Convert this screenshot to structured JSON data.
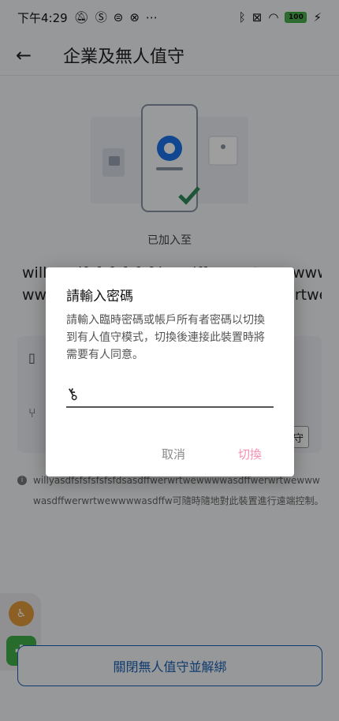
{
  "status": {
    "time": "下午4:29",
    "left_icons": [
      "notifications-off-icon",
      "s-icon",
      "vpn-icon",
      "app-icon",
      "more-dots-icon"
    ],
    "right_icons": [
      "bluetooth-icon",
      "no-sim-icon",
      "wifi-icon",
      "battery-icon",
      "charging-icon"
    ],
    "battery": "100"
  },
  "appbar": {
    "title": "企業及無人值守"
  },
  "content": {
    "added_label": "已加入至",
    "org_name_line1": "willyasdfsfsfsfsfsfdsasdffwerwrtwewwwww",
    "org_name_line2": "wwwasdffwerwrtwewwwwasdffwerwrtwewwwww",
    "card_button_label": "守",
    "notice_text": "willyasdfsfsfsfsfsfdsasdffwerwrtwewwwwasdffwerwrtwewwwwasdffwerwrtwewwwwasdffw可隨時隨地對此裝置進行遠端控制。"
  },
  "bottom_button": {
    "label": "關閉無人值守並解綁"
  },
  "dialog": {
    "title": "請輸入密碼",
    "body": "請輸入臨時密碼或帳戶所有者密碼以切換到有人值守模式，切換後連接此裝置時將需要有人同意。",
    "password_value": "",
    "password_placeholder": "",
    "cancel_label": "取消",
    "switch_label": "切換"
  },
  "colors": {
    "accent": "#1a5fb4",
    "switch_disabled": "#f48fb1",
    "fab_orange": "#e39b3b",
    "fab_green": "#3fae4a"
  }
}
